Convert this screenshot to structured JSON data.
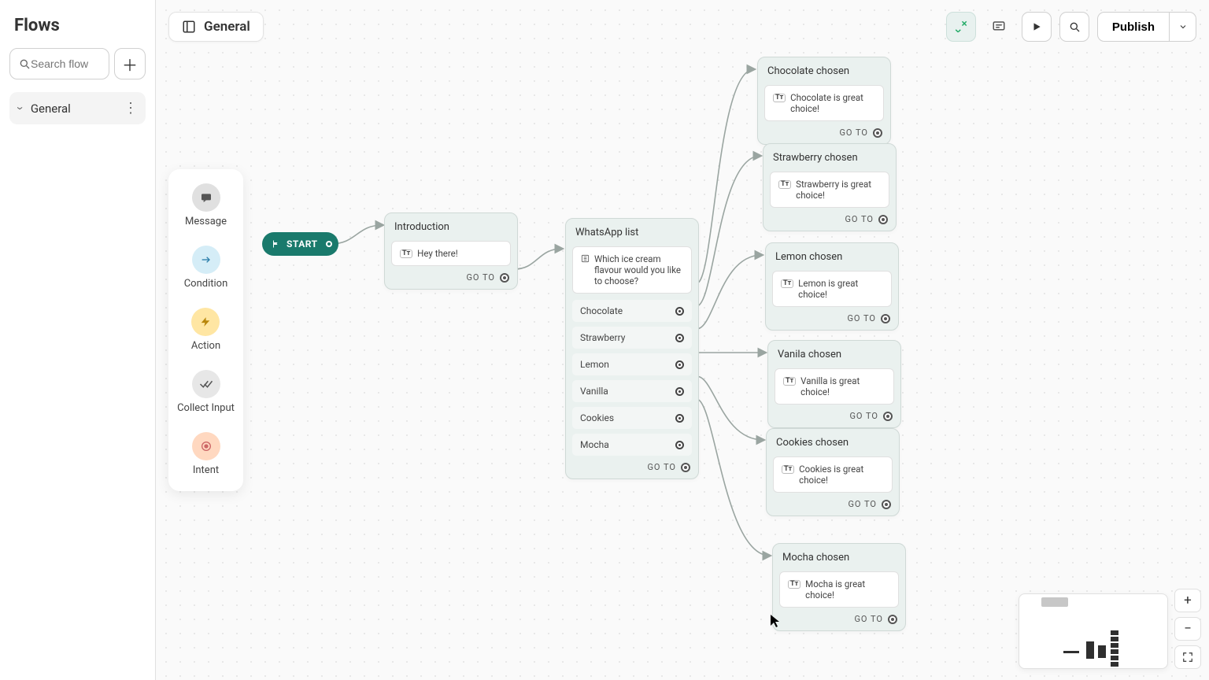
{
  "sidebar": {
    "title": "Flows",
    "search_placeholder": "Search flow",
    "items": [
      {
        "name": "General"
      }
    ]
  },
  "header": {
    "flow_name": "General",
    "publish_label": "Publish"
  },
  "palette": [
    {
      "label": "Message"
    },
    {
      "label": "Condition"
    },
    {
      "label": "Action"
    },
    {
      "label": "Collect Input"
    },
    {
      "label": "Intent"
    }
  ],
  "start": {
    "label": "START"
  },
  "nodes": {
    "intro": {
      "title": "Introduction",
      "text": "Hey there!",
      "goto": "GO  TO"
    },
    "walist": {
      "title": "WhatsApp list",
      "question": "Which ice cream flavour would you like to choose?",
      "options": [
        "Chocolate",
        "Strawberry",
        "Lemon",
        "Vanilla",
        "Cookies",
        "Mocha"
      ],
      "goto": "GO  TO"
    },
    "choc": {
      "title": "Chocolate chosen",
      "text": "Chocolate is great choice!",
      "goto": "GO  TO"
    },
    "straw": {
      "title": "Strawberry chosen",
      "text": "Strawberry is great choice!",
      "goto": "GO  TO"
    },
    "lemon": {
      "title": "Lemon chosen",
      "text": "Lemon is great choice!",
      "goto": "GO  TO"
    },
    "vanila": {
      "title": "Vanila chosen",
      "text": "Vanilla is great choice!",
      "goto": "GO  TO"
    },
    "cookies": {
      "title": "Cookies chosen",
      "text": "Cookies is great choice!",
      "goto": "GO  TO"
    },
    "mocha": {
      "title": "Mocha chosen",
      "text": "Mocha is great choice!",
      "goto": "GO  TO"
    }
  }
}
